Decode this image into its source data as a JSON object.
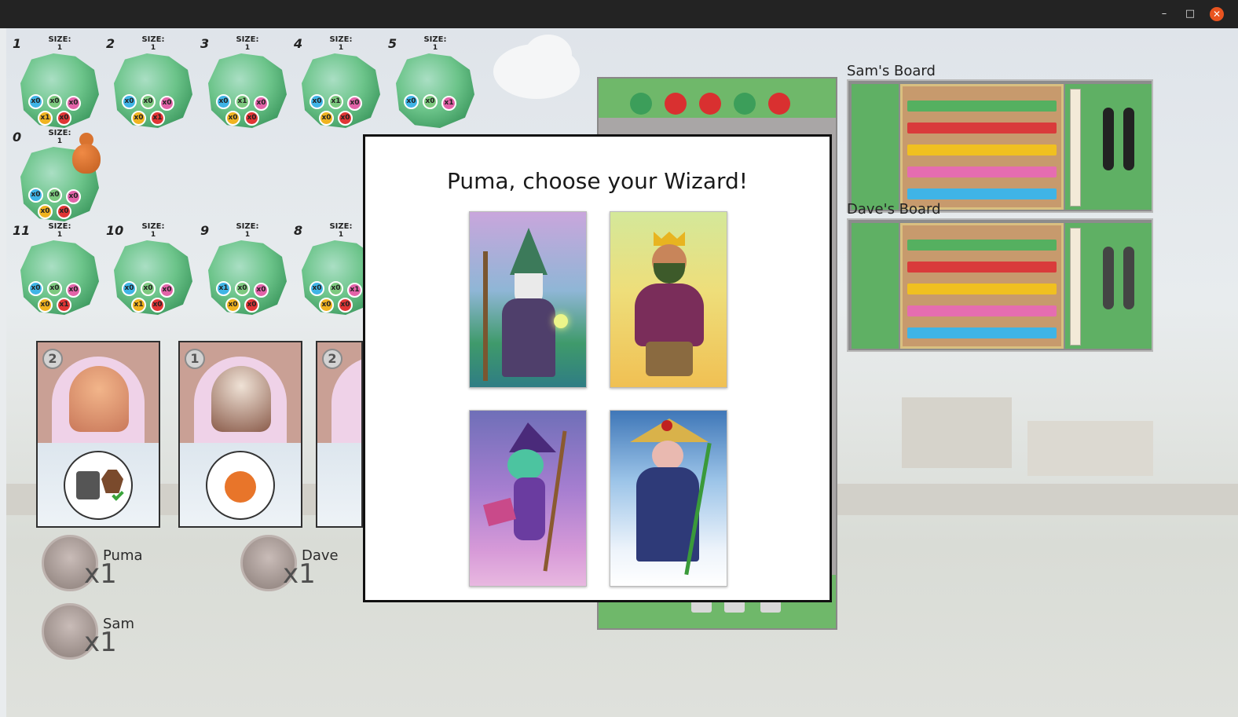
{
  "window": {
    "minimize": "–",
    "maximize": "□",
    "close": "✕"
  },
  "tiles": [
    {
      "number": "1",
      "size_label": "SIZE:",
      "size": "1",
      "tokens": [
        {
          "color": "c1",
          "label": "x0"
        },
        {
          "color": "c2",
          "label": "x0"
        },
        {
          "color": "c3",
          "label": "x0"
        },
        {
          "color": "c4",
          "label": "x1"
        },
        {
          "color": "c5",
          "label": "x0"
        }
      ]
    },
    {
      "number": "2",
      "size_label": "SIZE:",
      "size": "1",
      "tokens": [
        {
          "color": "c1",
          "label": "x0"
        },
        {
          "color": "c2",
          "label": "x0"
        },
        {
          "color": "c3",
          "label": "x0"
        },
        {
          "color": "c4",
          "label": "x0"
        },
        {
          "color": "c5",
          "label": "x1"
        }
      ]
    },
    {
      "number": "3",
      "size_label": "SIZE:",
      "size": "1",
      "tokens": [
        {
          "color": "c1",
          "label": "x0"
        },
        {
          "color": "c2",
          "label": "x1"
        },
        {
          "color": "c3",
          "label": "x0"
        },
        {
          "color": "c4",
          "label": "x0"
        },
        {
          "color": "c5",
          "label": "x0"
        }
      ]
    },
    {
      "number": "4",
      "size_label": "SIZE:",
      "size": "1",
      "tokens": [
        {
          "color": "c1",
          "label": "x0"
        },
        {
          "color": "c2",
          "label": "x1"
        },
        {
          "color": "c3",
          "label": "x0"
        },
        {
          "color": "c4",
          "label": "x0"
        },
        {
          "color": "c5",
          "label": "x0"
        }
      ]
    },
    {
      "number": "5",
      "size_label": "SIZE:",
      "size": "1",
      "tokens": [
        {
          "color": "c1",
          "label": "x0"
        },
        {
          "color": "c2",
          "label": "x0"
        },
        {
          "color": "c3",
          "label": "x1"
        }
      ]
    },
    {
      "number": "0",
      "size_label": "SIZE:",
      "size": "1",
      "tokens": [
        {
          "color": "c1",
          "label": "x0"
        },
        {
          "color": "c2",
          "label": "x0"
        },
        {
          "color": "c3",
          "label": "x0"
        },
        {
          "color": "c4",
          "label": "x0"
        },
        {
          "color": "c5",
          "label": "x0"
        }
      ]
    },
    {
      "number": "11",
      "size_label": "SIZE:",
      "size": "1",
      "tokens": [
        {
          "color": "c1",
          "label": "x0"
        },
        {
          "color": "c2",
          "label": "x0"
        },
        {
          "color": "c3",
          "label": "x0"
        },
        {
          "color": "c4",
          "label": "x0"
        },
        {
          "color": "c5",
          "label": "x1"
        }
      ]
    },
    {
      "number": "10",
      "size_label": "SIZE:",
      "size": "1",
      "tokens": [
        {
          "color": "c1",
          "label": "x0"
        },
        {
          "color": "c2",
          "label": "x0"
        },
        {
          "color": "c3",
          "label": "x0"
        },
        {
          "color": "c4",
          "label": "x1"
        },
        {
          "color": "c5",
          "label": "x0"
        }
      ]
    },
    {
      "number": "9",
      "size_label": "SIZE:",
      "size": "1",
      "tokens": [
        {
          "color": "c1",
          "label": "x1"
        },
        {
          "color": "c2",
          "label": "x0"
        },
        {
          "color": "c3",
          "label": "x0"
        },
        {
          "color": "c4",
          "label": "x0"
        },
        {
          "color": "c5",
          "label": "x0"
        }
      ]
    },
    {
      "number": "8",
      "size_label": "SIZE:",
      "size": "1",
      "tokens": [
        {
          "color": "c1",
          "label": "x0"
        },
        {
          "color": "c2",
          "label": "x0"
        },
        {
          "color": "c3",
          "label": "x1"
        },
        {
          "color": "c4",
          "label": "x0"
        },
        {
          "color": "c5",
          "label": "x0"
        }
      ]
    }
  ],
  "cards": [
    {
      "cost": "2"
    },
    {
      "cost": "1"
    },
    {
      "cost": "2"
    }
  ],
  "players": [
    {
      "name": "Puma",
      "count": "x1"
    },
    {
      "name": "Dave",
      "count": "x1"
    },
    {
      "name": "Sam",
      "count": "x1"
    }
  ],
  "boards": {
    "sam": "Sam's Board",
    "dave": "Dave's Board"
  },
  "modal": {
    "title": "Puma, choose your Wizard!",
    "wizards": [
      {
        "icon": "green-robed-wizard-icon"
      },
      {
        "icon": "crowned-king-wizard-icon"
      },
      {
        "icon": "purple-witch-wizard-icon"
      },
      {
        "icon": "straw-hat-sage-wizard-icon"
      }
    ]
  },
  "colors": {
    "blue": "#3fb4e6",
    "green": "#7dc97f",
    "pink": "#e263a8",
    "yellow": "#f0b320",
    "red": "#e03535",
    "pawn": "#d9732f"
  }
}
